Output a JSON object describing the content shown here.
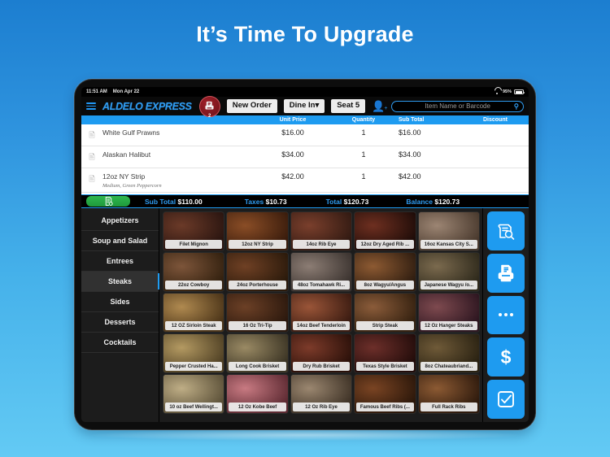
{
  "headline": "It’s Time To Upgrade",
  "statusbar": {
    "time": "11:51 AM",
    "date": "Mon Apr 22",
    "battery": "95%",
    "wifi_icon": "wifi-icon",
    "battery_icon": "battery-icon"
  },
  "topbar": {
    "menu_icon": "hamburger-menu-icon",
    "brand": "ALDELO EXPRESS",
    "printer_icon": "printer-icon",
    "printer_count": "2",
    "new_order": "New Order",
    "order_type": "Dine In",
    "order_type_caret": "▾",
    "seat": "Seat 5",
    "add_user_icon": "add-user-icon",
    "search_placeholder": "Item Name or Barcode",
    "search_value": "",
    "search_icon": "search-icon"
  },
  "columns": {
    "item": "",
    "unit_price": "Unit Price",
    "quantity": "Quantity",
    "sub_total": "Sub Total",
    "discount": "Discount"
  },
  "order_items": [
    {
      "icon": "duplicate-item-icon",
      "name": "White Gulf Prawns",
      "modifiers": "",
      "unit_price": "$16.00",
      "quantity": "1",
      "sub_total": "$16.00",
      "discount": ""
    },
    {
      "icon": "duplicate-item-icon",
      "name": "Alaskan Halibut",
      "modifiers": "",
      "unit_price": "$34.00",
      "quantity": "1",
      "sub_total": "$34.00",
      "discount": ""
    },
    {
      "icon": "duplicate-item-icon",
      "name": "12oz NY Strip",
      "modifiers": "Medium, Green Peppercorn",
      "unit_price": "$42.00",
      "quantity": "1",
      "sub_total": "$42.00",
      "discount": ""
    }
  ],
  "totals": {
    "receipt_button_icon": "receipt-order-icon",
    "sub_total_label": "Sub Total",
    "sub_total_value": "$110.00",
    "taxes_label": "Taxes",
    "taxes_value": "$10.73",
    "total_label": "Total",
    "total_value": "$120.73",
    "balance_label": "Balance",
    "balance_value": "$120.73"
  },
  "categories": [
    {
      "label": "Appetizers",
      "active": false
    },
    {
      "label": "Soup and Salad",
      "active": false
    },
    {
      "label": "Entrees",
      "active": false
    },
    {
      "label": "Steaks",
      "active": true
    },
    {
      "label": "Sides",
      "active": false
    },
    {
      "label": "Desserts",
      "active": false
    },
    {
      "label": "Cocktails",
      "active": false
    }
  ],
  "items": [
    {
      "label": "Filet Mignon",
      "c1": "#6b3a28",
      "c2": "#2a1510"
    },
    {
      "label": "12oz NY Strip",
      "c1": "#8a4d26",
      "c2": "#3a1c0c"
    },
    {
      "label": "14oz Rib Eye",
      "c1": "#7a3f2c",
      "c2": "#321a12"
    },
    {
      "label": "12oz Dry Aged Rib ...",
      "c1": "#6e2f20",
      "c2": "#1e0c08"
    },
    {
      "label": "16oz Kansas City S...",
      "c1": "#9c8573",
      "c2": "#4a3a2e"
    },
    {
      "label": "22oz Cowboy",
      "c1": "#7d553a",
      "c2": "#33210f"
    },
    {
      "label": "24oz Porterhouse",
      "c1": "#6f4024",
      "c2": "#2b1a0b"
    },
    {
      "label": "48oz Tomahawk Ri...",
      "c1": "#8c7d74",
      "c2": "#3c3430"
    },
    {
      "label": "8oz Wagyu/Angus",
      "c1": "#8d5a32",
      "c2": "#2f1d10"
    },
    {
      "label": "Japanese Wagyu /o...",
      "c1": "#7b6a4e",
      "c2": "#2f2a1c"
    },
    {
      "label": "12 OZ Sirloin Steak",
      "c1": "#b08a50",
      "c2": "#4b3418"
    },
    {
      "label": "16 Oz Tri-Tip",
      "c1": "#6c4026",
      "c2": "#2b180d"
    },
    {
      "label": "14oz Beef Tenderloin",
      "c1": "#9a5538",
      "c2": "#3a1b11"
    },
    {
      "label": "Strip Steak",
      "c1": "#8b5c3a",
      "c2": "#33200f"
    },
    {
      "label": "12 Oz Hanger Steaks",
      "c1": "#7e4a4f",
      "c2": "#2d1620"
    },
    {
      "label": "Pepper Crusted Ha...",
      "c1": "#b49a62",
      "c2": "#4f4024"
    },
    {
      "label": "Long Cook Brisket",
      "c1": "#9a8a64",
      "c2": "#3b3424"
    },
    {
      "label": "Dry Rub Brisket",
      "c1": "#7d3b2a",
      "c2": "#2a1009"
    },
    {
      "label": "Texas Style Brisket",
      "c1": "#6d2f2a",
      "c2": "#220c0a"
    },
    {
      "label": "8oz Chateaubriand...",
      "c1": "#6f5a38",
      "c2": "#2a2212"
    },
    {
      "label": "10 oz Beef Wellingt...",
      "c1": "#bfae86",
      "c2": "#5b5038"
    },
    {
      "label": "12 Oz Kobe Beef",
      "c1": "#c87a82",
      "c2": "#5d2a32"
    },
    {
      "label": "12 Oz Rib Eye",
      "c1": "#9b8770",
      "c2": "#3e3226"
    },
    {
      "label": "Famous Beef Ribs (...",
      "c1": "#7a4423",
      "c2": "#2b170a"
    },
    {
      "label": "Full Rack Ribs",
      "c1": "#8c5a33",
      "c2": "#2e1a0d"
    }
  ],
  "actions": [
    {
      "icon": "order-lookup-icon"
    },
    {
      "icon": "print-receipt-icon"
    },
    {
      "icon": "more-options-icon"
    },
    {
      "icon": "payment-dollar-icon"
    },
    {
      "icon": "close-order-checkbox-icon"
    }
  ],
  "colors": {
    "accent": "#1e9bf0",
    "brand": "#2f9bf0",
    "green": "#2fb84e",
    "page_bg_top": "#1c7ed0",
    "page_bg_bottom": "#63caf4"
  }
}
